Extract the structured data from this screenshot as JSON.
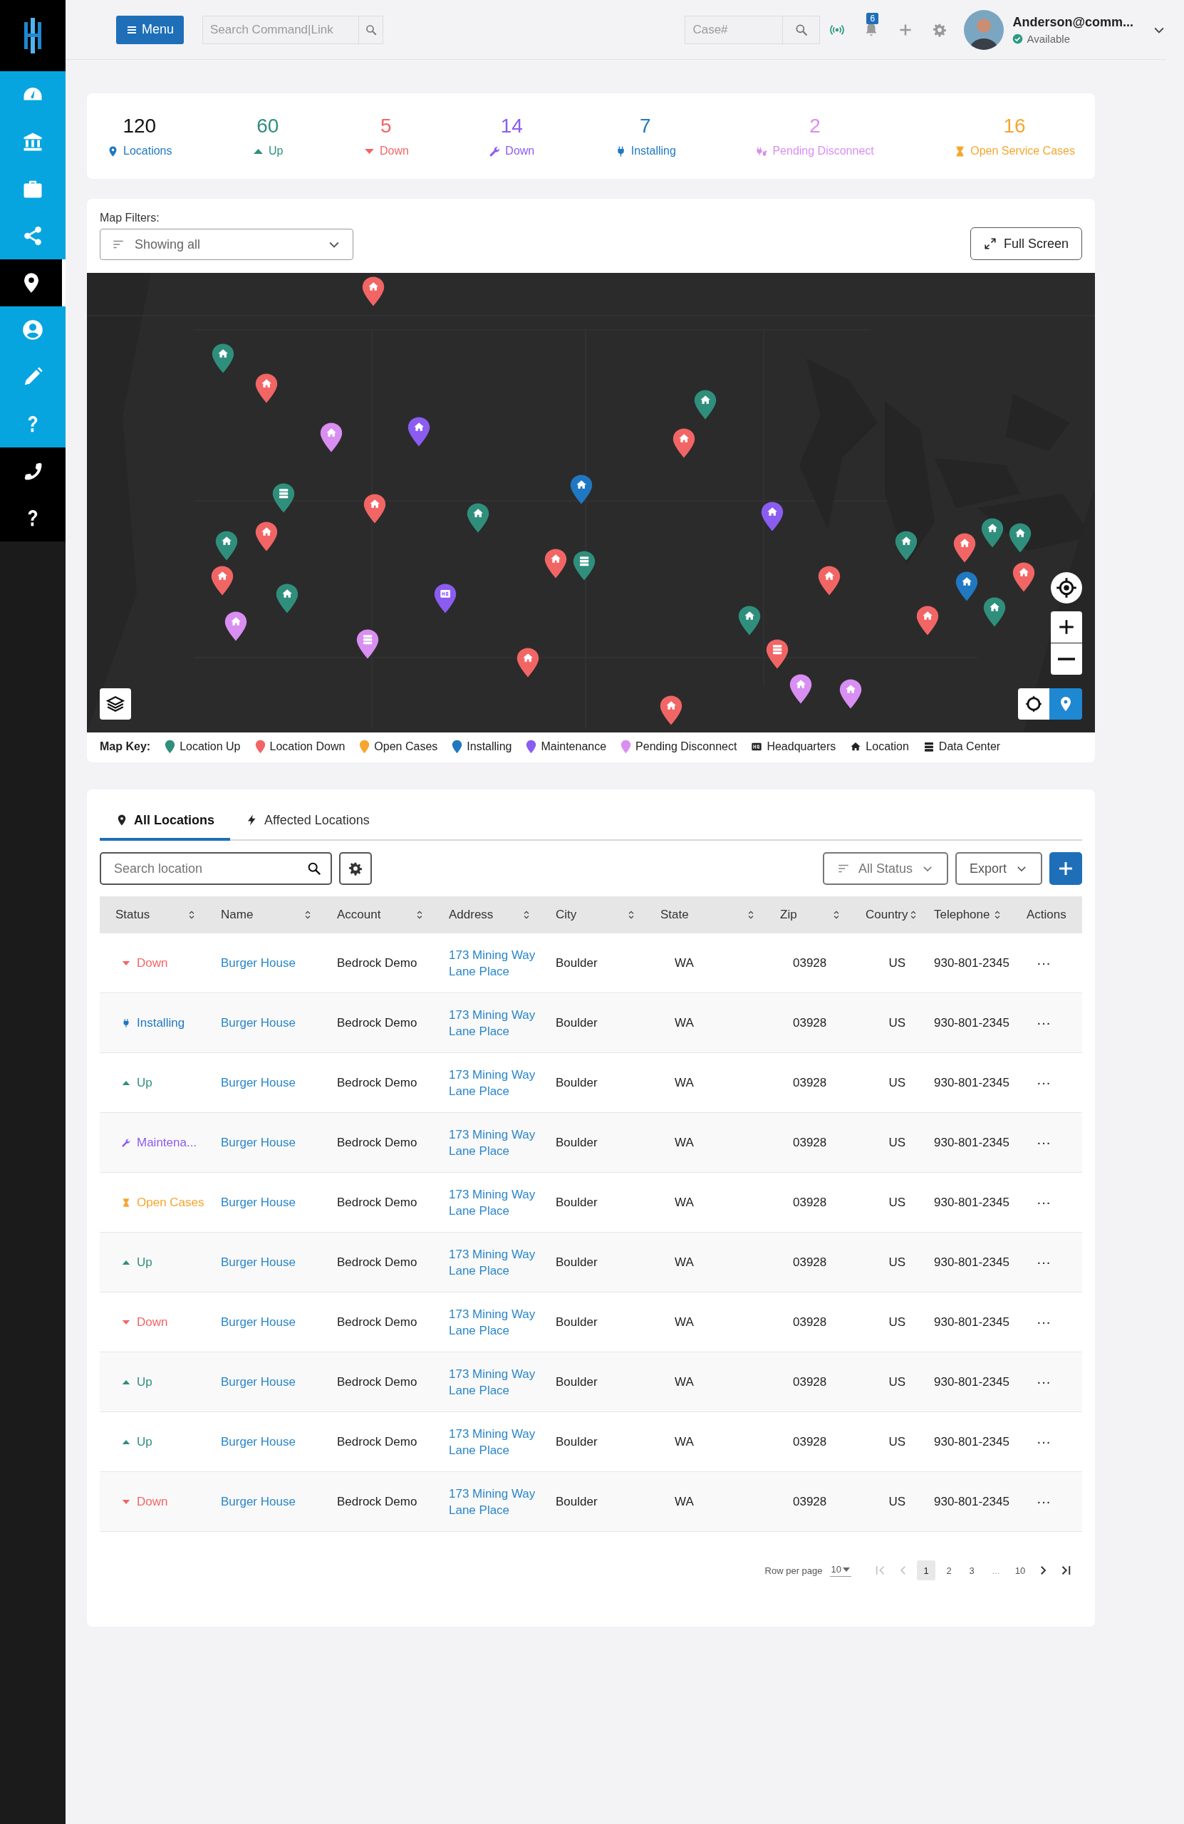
{
  "sidebar": {
    "items": [
      {
        "kind": "dashboard",
        "selected": false
      },
      {
        "kind": "bank",
        "selected": false
      },
      {
        "kind": "briefcase",
        "selected": false
      },
      {
        "kind": "share",
        "selected": false
      },
      {
        "kind": "pin",
        "selected": true
      },
      {
        "kind": "user",
        "selected": false
      },
      {
        "kind": "pencil",
        "selected": false
      },
      {
        "kind": "help",
        "selected": false
      }
    ],
    "contact_items": [
      {
        "kind": "phone",
        "selected": false
      },
      {
        "kind": "help",
        "selected": false
      }
    ]
  },
  "header": {
    "menu_button": "Menu",
    "search": {
      "placeholder": "Search Command|Link"
    },
    "case_search": {
      "placeholder": "Case#"
    },
    "notifications": {
      "count": "6"
    },
    "user": {
      "name": "Anderson@comm...",
      "status": "Available"
    }
  },
  "stats": [
    {
      "kind": "locations",
      "value": "120",
      "label": "Locations"
    },
    {
      "kind": "up",
      "value": "60",
      "label": "Up"
    },
    {
      "kind": "down",
      "value": "5",
      "label": "Down"
    },
    {
      "kind": "maintenance",
      "value": "14",
      "label": "Down"
    },
    {
      "kind": "installing",
      "value": "7",
      "label": "Installing"
    },
    {
      "kind": "pending",
      "value": "2",
      "label": "Pending Disconnect"
    },
    {
      "kind": "open",
      "value": "16",
      "label": "Open Service Cases"
    }
  ],
  "map": {
    "filter_label": "Map Filters:",
    "filter": {
      "value": "Showing all"
    },
    "full_screen": "Full Screen",
    "location_pins": [
      {
        "kind": "down"
      },
      {
        "kind": "up"
      },
      {
        "kind": "down"
      },
      {
        "kind": "pending"
      },
      {
        "kind": "maintenance"
      },
      {
        "kind": "down"
      },
      {
        "kind": "up"
      },
      {
        "kind": "down"
      },
      {
        "kind": "down"
      },
      {
        "kind": "up"
      },
      {
        "kind": "pending"
      },
      {
        "kind": "up"
      },
      {
        "kind": "down"
      },
      {
        "kind": "down"
      },
      {
        "kind": "installing"
      },
      {
        "kind": "up"
      },
      {
        "kind": "down"
      },
      {
        "kind": "maintenance"
      },
      {
        "kind": "up"
      },
      {
        "kind": "down"
      },
      {
        "kind": "pending"
      },
      {
        "kind": "pending"
      },
      {
        "kind": "down"
      },
      {
        "kind": "up"
      },
      {
        "kind": "down"
      },
      {
        "kind": "down"
      },
      {
        "kind": "up"
      },
      {
        "kind": "installing"
      },
      {
        "kind": "up"
      },
      {
        "kind": "up"
      },
      {
        "kind": "down"
      }
    ],
    "datacenter_pins": [
      {
        "kind": "up"
      },
      {
        "kind": "pending"
      },
      {
        "kind": "up"
      },
      {
        "kind": "down"
      }
    ],
    "headquarters_pins": [
      {
        "kind": "maintenance"
      }
    ],
    "key": {
      "title": "Map Key:",
      "items": [
        {
          "kind": "up",
          "label": "Location Up"
        },
        {
          "kind": "down",
          "label": "Location Down"
        },
        {
          "kind": "open",
          "label": "Open Cases"
        },
        {
          "kind": "installing",
          "label": "Installing"
        },
        {
          "kind": "maintenance",
          "label": "Maintenance"
        },
        {
          "kind": "pending",
          "label": "Pending Disconnect"
        },
        {
          "kind": "hq",
          "label": "Headquarters"
        },
        {
          "kind": "location",
          "label": "Location"
        },
        {
          "kind": "datacenter",
          "label": "Data Center"
        }
      ]
    }
  },
  "locations": {
    "tabs": [
      {
        "kind": "pin",
        "label": "All Locations",
        "selected": true
      },
      {
        "kind": "bolt",
        "label": "Affected Locations",
        "selected": false
      }
    ],
    "search": {
      "placeholder": "Search location"
    },
    "status_filter": "All Status",
    "export_button": "Export",
    "columns": [
      "Status",
      "Name",
      "Account",
      "Address",
      "City",
      "State",
      "Zip",
      "Country",
      "Telephone",
      "Actions"
    ],
    "rows": [
      {
        "status": {
          "kind": "down",
          "label": "Down"
        },
        "name": "Burger House",
        "account": "Bedrock Demo",
        "address": "173 Mining Way Lane Place",
        "city": "Boulder",
        "state": "WA",
        "zip": "03928",
        "country": "US",
        "telephone": "930-801-2345",
        "actions": "···"
      },
      {
        "status": {
          "kind": "installing",
          "label": "Installing"
        },
        "name": "Burger House",
        "account": "Bedrock Demo",
        "address": "173 Mining Way Lane Place",
        "city": "Boulder",
        "state": "WA",
        "zip": "03928",
        "country": "US",
        "telephone": "930-801-2345",
        "actions": "···"
      },
      {
        "status": {
          "kind": "up",
          "label": "Up"
        },
        "name": "Burger House",
        "account": "Bedrock Demo",
        "address": "173 Mining Way Lane Place",
        "city": "Boulder",
        "state": "WA",
        "zip": "03928",
        "country": "US",
        "telephone": "930-801-2345",
        "actions": "···"
      },
      {
        "status": {
          "kind": "maintenance",
          "label": "Maintena..."
        },
        "name": "Burger House",
        "account": "Bedrock Demo",
        "address": "173 Mining Way Lane Place",
        "city": "Boulder",
        "state": "WA",
        "zip": "03928",
        "country": "US",
        "telephone": "930-801-2345",
        "actions": "···"
      },
      {
        "status": {
          "kind": "open",
          "label": "Open Cases"
        },
        "name": "Burger House",
        "account": "Bedrock Demo",
        "address": "173 Mining Way Lane Place",
        "city": "Boulder",
        "state": "WA",
        "zip": "03928",
        "country": "US",
        "telephone": "930-801-2345",
        "actions": "···"
      },
      {
        "status": {
          "kind": "up",
          "label": "Up"
        },
        "name": "Burger House",
        "account": "Bedrock Demo",
        "address": "173 Mining Way Lane Place",
        "city": "Boulder",
        "state": "WA",
        "zip": "03928",
        "country": "US",
        "telephone": "930-801-2345",
        "actions": "···"
      },
      {
        "status": {
          "kind": "down",
          "label": "Down"
        },
        "name": "Burger House",
        "account": "Bedrock Demo",
        "address": "173 Mining Way Lane Place",
        "city": "Boulder",
        "state": "WA",
        "zip": "03928",
        "country": "US",
        "telephone": "930-801-2345",
        "actions": "···"
      },
      {
        "status": {
          "kind": "up",
          "label": "Up"
        },
        "name": "Burger House",
        "account": "Bedrock Demo",
        "address": "173 Mining Way Lane Place",
        "city": "Boulder",
        "state": "WA",
        "zip": "03928",
        "country": "US",
        "telephone": "930-801-2345",
        "actions": "···"
      },
      {
        "status": {
          "kind": "up",
          "label": "Up"
        },
        "name": "Burger House",
        "account": "Bedrock Demo",
        "address": "173 Mining Way Lane Place",
        "city": "Boulder",
        "state": "WA",
        "zip": "03928",
        "country": "US",
        "telephone": "930-801-2345",
        "actions": "···"
      },
      {
        "status": {
          "kind": "down",
          "label": "Down"
        },
        "name": "Burger House",
        "account": "Bedrock Demo",
        "address": "173 Mining Way Lane Place",
        "city": "Boulder",
        "state": "WA",
        "zip": "03928",
        "country": "US",
        "telephone": "930-801-2345",
        "actions": "···"
      }
    ],
    "pagination": {
      "rows_per_page_label": "Row per page",
      "rows_per_page": "10",
      "pages": [
        {
          "label": "1",
          "selected": true
        },
        {
          "label": "2",
          "selected": false
        },
        {
          "label": "3",
          "selected": false
        }
      ],
      "ellipsis": "...",
      "last_page": "10"
    }
  }
}
